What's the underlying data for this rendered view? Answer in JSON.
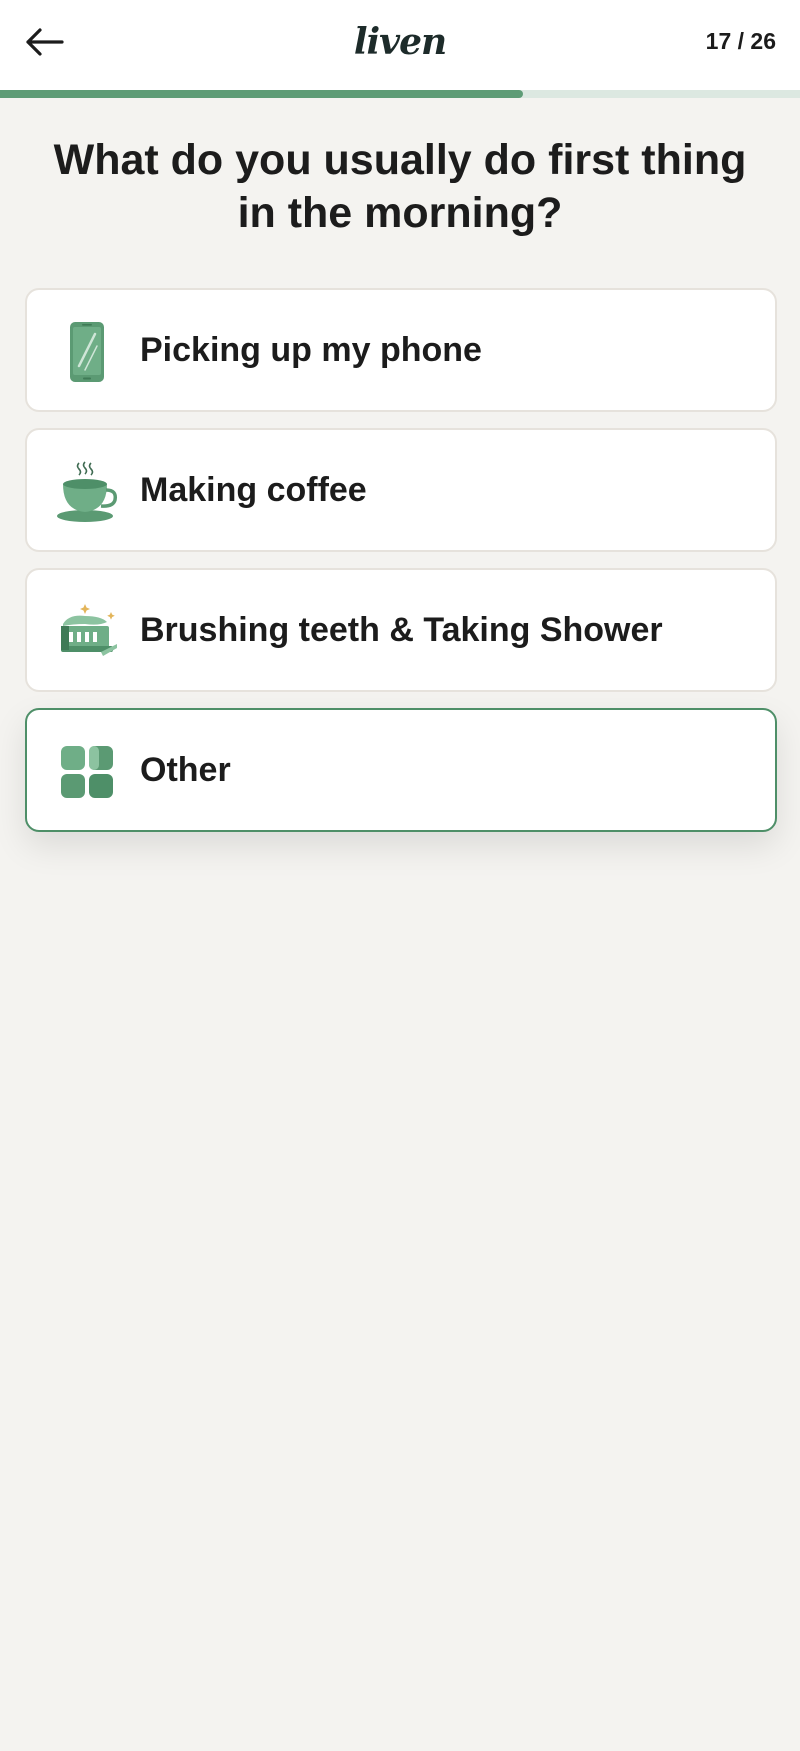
{
  "header": {
    "back_icon": "arrow-left-icon",
    "logo_text": "liven",
    "step_counter": "17 / 26",
    "progress": {
      "current": 17,
      "total": 26
    }
  },
  "colors": {
    "accent": "#5e9c76",
    "selected_border": "#4e8f68",
    "background": "#f4f3f0"
  },
  "question": {
    "title": "What do you usually do first thing in the morning?"
  },
  "options": [
    {
      "label": "Picking up my phone",
      "icon": "smartphone-icon",
      "selected": false
    },
    {
      "label": "Making coffee",
      "icon": "coffee-cup-icon",
      "selected": false
    },
    {
      "label": "Brushing teeth & Taking Shower",
      "icon": "toothbrush-icon",
      "selected": false
    },
    {
      "label": "Other",
      "icon": "grid-icon",
      "selected": true
    }
  ]
}
